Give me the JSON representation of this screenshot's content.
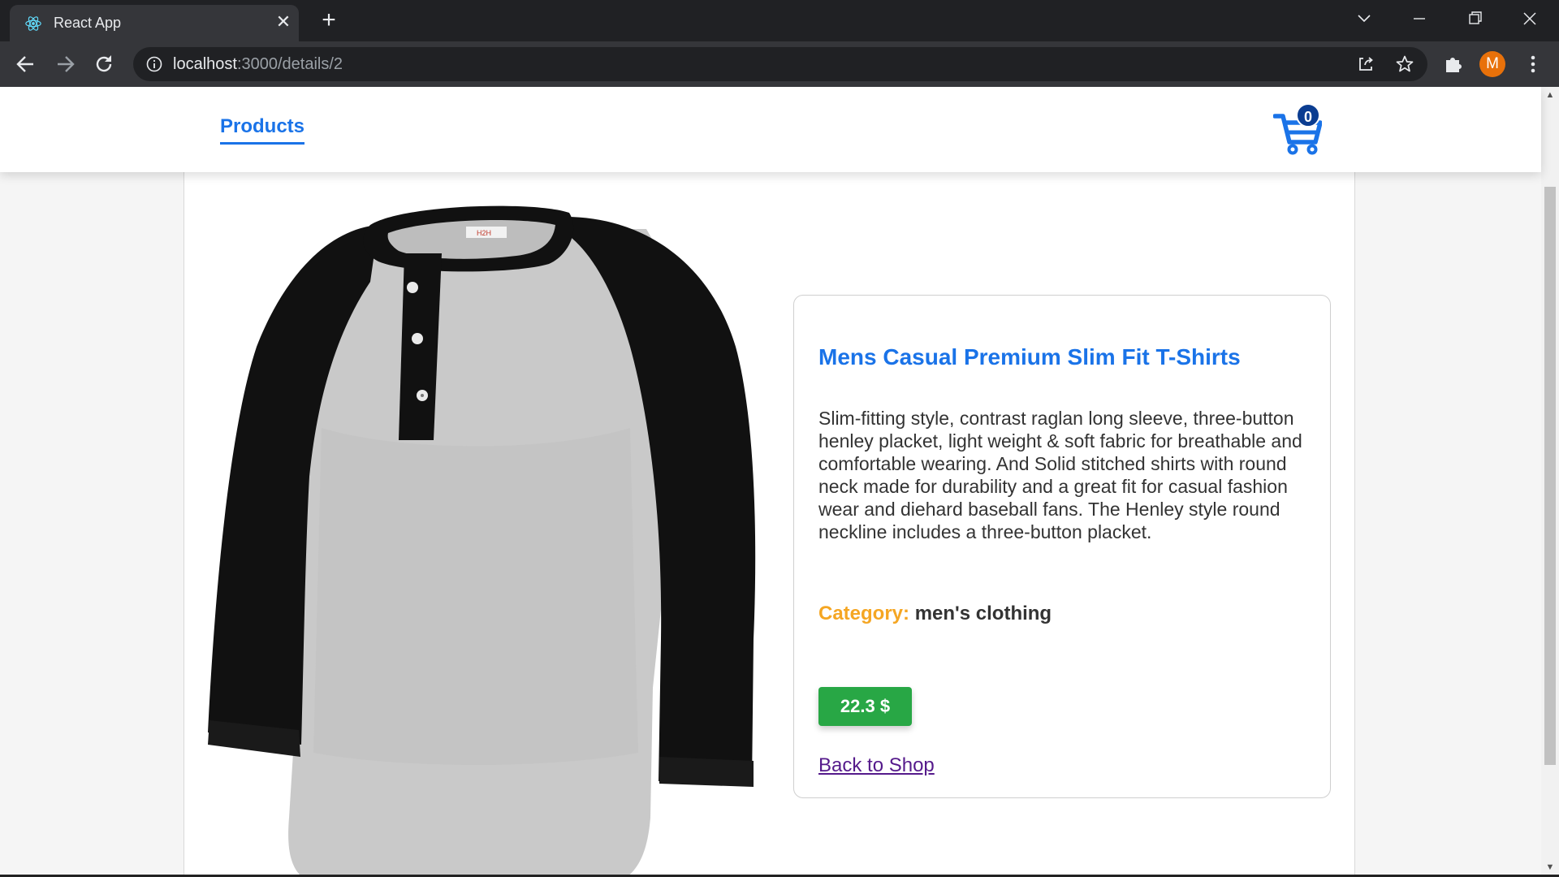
{
  "browser": {
    "tab_title": "React App",
    "url_host": "localhost",
    "url_rest": ":3000/details/2",
    "profile_initial": "M"
  },
  "navbar": {
    "products_link": "Products",
    "cart_count": "0"
  },
  "product": {
    "title": "Mens Casual Premium Slim Fit T-Shirts",
    "description": "Slim-fitting style, contrast raglan long sleeve, three-button henley placket, light weight & soft fabric for breathable and comfortable wearing. And Solid stitched shirts with round neck made for durability and a great fit for casual fashion wear and diehard baseball fans. The Henley style round neckline includes a three-button placket.",
    "category_label": "Category:",
    "category_value": "men's clothing",
    "price": "22.3 $",
    "back_link": "Back to Shop",
    "tag_text": "H2H"
  },
  "colors": {
    "accent": "#1a73e8",
    "price_bg": "#28a745",
    "category_label": "#f5a623"
  }
}
